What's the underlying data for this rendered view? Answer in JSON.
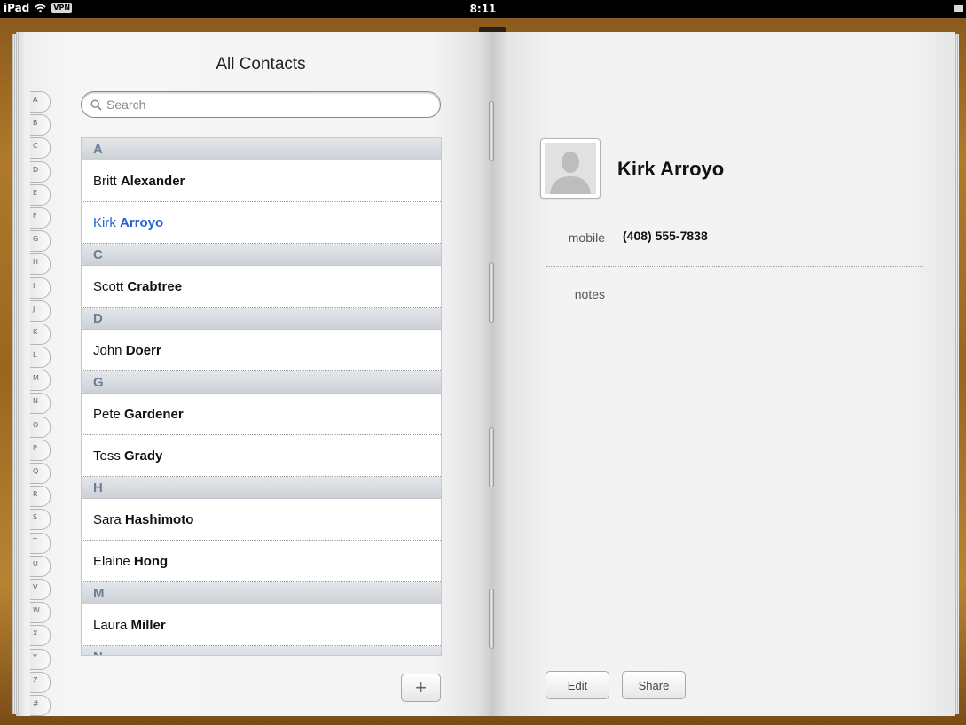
{
  "status_bar": {
    "device": "iPad",
    "vpn": "VPN",
    "time": "8:11"
  },
  "contacts_page": {
    "title": "All Contacts",
    "search_placeholder": "Search",
    "index_letters": [
      "A",
      "B",
      "C",
      "D",
      "E",
      "F",
      "G",
      "H",
      "I",
      "J",
      "K",
      "L",
      "M",
      "N",
      "O",
      "P",
      "Q",
      "R",
      "S",
      "T",
      "U",
      "V",
      "W",
      "X",
      "Y",
      "Z",
      "#"
    ],
    "sections": [
      {
        "letter": "A",
        "contacts": [
          {
            "first": "Britt",
            "last": "Alexander",
            "selected": false
          },
          {
            "first": "Kirk",
            "last": "Arroyo",
            "selected": true
          }
        ]
      },
      {
        "letter": "C",
        "contacts": [
          {
            "first": "Scott",
            "last": "Crabtree",
            "selected": false
          }
        ]
      },
      {
        "letter": "D",
        "contacts": [
          {
            "first": "John",
            "last": "Doerr",
            "selected": false
          }
        ]
      },
      {
        "letter": "G",
        "contacts": [
          {
            "first": "Pete",
            "last": "Gardener",
            "selected": false
          },
          {
            "first": "Tess",
            "last": "Grady",
            "selected": false
          }
        ]
      },
      {
        "letter": "H",
        "contacts": [
          {
            "first": "Sara",
            "last": "Hashimoto",
            "selected": false
          },
          {
            "first": "Elaine",
            "last": "Hong",
            "selected": false
          }
        ]
      },
      {
        "letter": "M",
        "contacts": [
          {
            "first": "Laura",
            "last": "Miller",
            "selected": false
          }
        ]
      },
      {
        "letter": "N",
        "contacts": []
      }
    ],
    "add_button_label": "+"
  },
  "detail_page": {
    "name": "Kirk Arroyo",
    "fields": {
      "mobile_label": "mobile",
      "mobile_value": "(408) 555-7838",
      "notes_label": "notes"
    },
    "edit_label": "Edit",
    "share_label": "Share"
  },
  "colors": {
    "selected_contact": "#2463d1",
    "section_header_text": "#6a7d99",
    "cover": "#9a6620"
  }
}
